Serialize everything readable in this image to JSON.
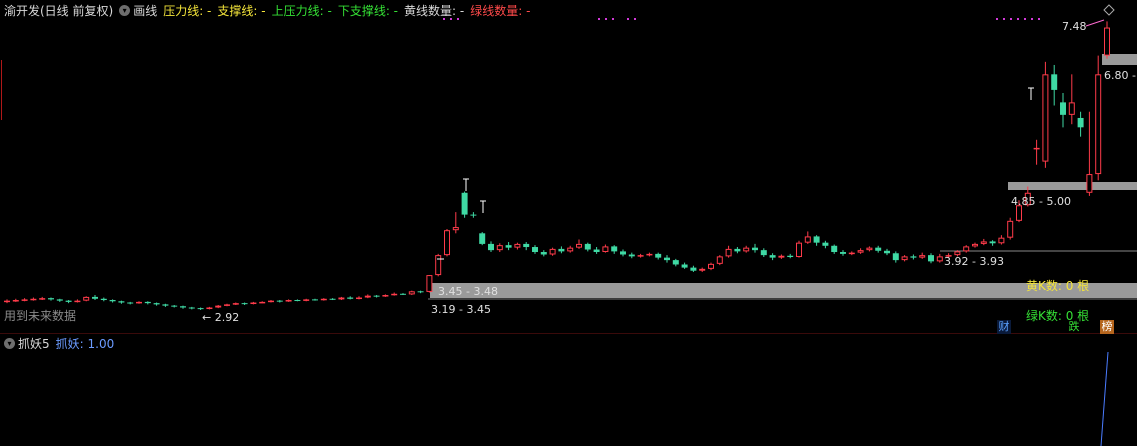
{
  "header": {
    "stock_name": "渝开发(日线 前复权)",
    "draw_label": "画线",
    "items": [
      {
        "label": "压力线: -",
        "color": "#f5e63a"
      },
      {
        "label": "支撑线: -",
        "color": "#f5e63a"
      },
      {
        "label": "上压力线: -",
        "color": "#35e035"
      },
      {
        "label": "下支撑线: -",
        "color": "#35e035"
      },
      {
        "label": "黄线数量: -",
        "color": "#d8d8d8"
      },
      {
        "label": "绿线数量: -",
        "color": "#ff4a4a"
      }
    ]
  },
  "sub_header": {
    "indicator": "抓妖5",
    "value_label": "抓妖: 1.00"
  },
  "annotations": {
    "future_data": "用到未来数据",
    "low_price": "← 2.92",
    "high_price": "7.48",
    "zone_345_348": "3.45 - 3.48",
    "zone_319_345": "3.19 - 3.45",
    "zone_392_393": "3.92 - 3.93",
    "zone_485_500": "4.85 - 5.00",
    "zone_680": "6.80 -",
    "yellow_k": "黄K数: 0 根",
    "green_k": "绿K数: 0 根",
    "badge_cai": "财",
    "badge_die": "跌",
    "badge_bang": "榜"
  },
  "colors": {
    "up": "#ff3b4a",
    "down": "#3fd9a4",
    "zone": "#9a9a9a",
    "magenta": "#d23ad8",
    "indicator_line": "#4a7cff"
  },
  "chart_data": {
    "type": "candlestick",
    "title": "渝开发(日线 前复权)",
    "ylim": [
      2.6,
      7.8
    ],
    "annotated_levels": {
      "low": 2.92,
      "high": 7.48
    },
    "zones": [
      {
        "label": "3.45 - 3.48",
        "low": 3.45,
        "high": 3.48
      },
      {
        "label": "3.19 - 3.45",
        "low": 3.19,
        "high": 3.45
      },
      {
        "label": "3.92 - 3.93",
        "low": 3.92,
        "high": 3.93
      },
      {
        "label": "4.85 - 5.00",
        "low": 4.85,
        "high": 5.0
      },
      {
        "label": "6.80 -",
        "low": 6.8,
        "high": 7.0
      }
    ],
    "candles": [
      [
        3.06,
        3.07,
        3.03,
        3.09
      ],
      [
        3.07,
        3.08,
        3.05,
        3.1
      ],
      [
        3.08,
        3.09,
        3.06,
        3.11
      ],
      [
        3.09,
        3.1,
        3.07,
        3.12
      ],
      [
        3.1,
        3.11,
        3.08,
        3.13
      ],
      [
        3.11,
        3.09,
        3.07,
        3.12
      ],
      [
        3.09,
        3.07,
        3.05,
        3.1
      ],
      [
        3.07,
        3.05,
        3.03,
        3.08
      ],
      [
        3.05,
        3.07,
        3.04,
        3.09
      ],
      [
        3.07,
        3.13,
        3.06,
        3.14
      ],
      [
        3.13,
        3.1,
        3.08,
        3.16
      ],
      [
        3.1,
        3.08,
        3.06,
        3.12
      ],
      [
        3.08,
        3.06,
        3.04,
        3.09
      ],
      [
        3.06,
        3.04,
        3.02,
        3.07
      ],
      [
        3.04,
        3.03,
        3.01,
        3.05
      ],
      [
        3.03,
        3.05,
        3.02,
        3.06
      ],
      [
        3.05,
        3.03,
        3.01,
        3.06
      ],
      [
        3.03,
        3.01,
        2.99,
        3.04
      ],
      [
        3.01,
        2.99,
        2.97,
        3.02
      ],
      [
        2.99,
        2.98,
        2.96,
        3.0
      ],
      [
        2.98,
        2.96,
        2.94,
        2.99
      ],
      [
        2.96,
        2.95,
        2.93,
        2.97
      ],
      [
        2.95,
        2.94,
        2.92,
        2.96
      ],
      [
        2.94,
        2.96,
        2.93,
        2.97
      ],
      [
        2.96,
        2.99,
        2.95,
        3.0
      ],
      [
        2.99,
        3.01,
        2.98,
        3.02
      ],
      [
        3.01,
        3.03,
        3.0,
        3.04
      ],
      [
        3.03,
        3.02,
        3.0,
        3.04
      ],
      [
        3.02,
        3.04,
        3.01,
        3.05
      ],
      [
        3.04,
        3.05,
        3.03,
        3.06
      ],
      [
        3.05,
        3.07,
        3.04,
        3.08
      ],
      [
        3.07,
        3.06,
        3.04,
        3.08
      ],
      [
        3.06,
        3.08,
        3.05,
        3.09
      ],
      [
        3.08,
        3.07,
        3.06,
        3.09
      ],
      [
        3.07,
        3.09,
        3.06,
        3.1
      ],
      [
        3.09,
        3.08,
        3.07,
        3.1
      ],
      [
        3.08,
        3.1,
        3.07,
        3.11
      ],
      [
        3.1,
        3.09,
        3.08,
        3.11
      ],
      [
        3.09,
        3.12,
        3.08,
        3.13
      ],
      [
        3.12,
        3.1,
        3.09,
        3.14
      ],
      [
        3.1,
        3.12,
        3.09,
        3.14
      ],
      [
        3.12,
        3.15,
        3.11,
        3.17
      ],
      [
        3.15,
        3.14,
        3.12,
        3.16
      ],
      [
        3.14,
        3.16,
        3.13,
        3.17
      ],
      [
        3.16,
        3.18,
        3.15,
        3.2
      ],
      [
        3.18,
        3.17,
        3.16,
        3.19
      ],
      [
        3.17,
        3.22,
        3.16,
        3.23
      ],
      [
        3.22,
        3.21,
        3.19,
        3.23
      ],
      [
        3.21,
        3.48,
        3.2,
        3.48
      ],
      [
        3.48,
        3.8,
        3.46,
        3.82
      ],
      [
        3.8,
        4.2,
        3.78,
        4.22
      ],
      [
        4.2,
        4.25,
        4.15,
        4.49
      ],
      [
        4.8,
        4.45,
        4.4,
        4.82
      ],
      [
        4.45,
        4.44,
        4.4,
        4.49
      ],
      [
        4.15,
        3.98,
        3.96,
        4.17
      ],
      [
        3.98,
        3.88,
        3.85,
        4.02
      ],
      [
        3.88,
        3.96,
        3.85,
        3.99
      ],
      [
        3.96,
        3.92,
        3.88,
        4.01
      ],
      [
        3.92,
        3.98,
        3.89,
        4.0
      ],
      [
        3.98,
        3.93,
        3.88,
        4.01
      ],
      [
        3.93,
        3.85,
        3.82,
        3.96
      ],
      [
        3.85,
        3.81,
        3.78,
        3.88
      ],
      [
        3.81,
        3.9,
        3.79,
        3.92
      ],
      [
        3.9,
        3.86,
        3.83,
        3.94
      ],
      [
        3.86,
        3.92,
        3.84,
        3.95
      ],
      [
        3.92,
        3.98,
        3.9,
        4.05
      ],
      [
        3.98,
        3.89,
        3.86,
        4.0
      ],
      [
        3.89,
        3.85,
        3.82,
        3.93
      ],
      [
        3.85,
        3.94,
        3.84,
        3.97
      ],
      [
        3.94,
        3.86,
        3.82,
        3.96
      ],
      [
        3.86,
        3.81,
        3.78,
        3.89
      ],
      [
        3.81,
        3.78,
        3.75,
        3.84
      ],
      [
        3.78,
        3.8,
        3.76,
        3.82
      ],
      [
        3.8,
        3.82,
        3.78,
        3.84
      ],
      [
        3.82,
        3.76,
        3.73,
        3.84
      ],
      [
        3.76,
        3.72,
        3.68,
        3.8
      ],
      [
        3.72,
        3.65,
        3.62,
        3.74
      ],
      [
        3.65,
        3.6,
        3.58,
        3.68
      ],
      [
        3.6,
        3.55,
        3.53,
        3.63
      ],
      [
        3.55,
        3.58,
        3.53,
        3.6
      ],
      [
        3.58,
        3.66,
        3.56,
        3.68
      ],
      [
        3.66,
        3.78,
        3.64,
        3.8
      ],
      [
        3.78,
        3.9,
        3.76,
        3.95
      ],
      [
        3.9,
        3.86,
        3.83,
        3.93
      ],
      [
        3.86,
        3.92,
        3.84,
        3.95
      ],
      [
        3.92,
        3.88,
        3.84,
        3.98
      ],
      [
        3.88,
        3.8,
        3.77,
        3.91
      ],
      [
        3.8,
        3.76,
        3.72,
        3.83
      ],
      [
        3.76,
        3.79,
        3.74,
        3.81
      ],
      [
        3.79,
        3.77,
        3.75,
        3.82
      ],
      [
        3.77,
        4.0,
        3.76,
        4.03
      ],
      [
        4.0,
        4.1,
        3.98,
        4.18
      ],
      [
        4.1,
        4.0,
        3.95,
        4.12
      ],
      [
        4.0,
        3.95,
        3.91,
        4.03
      ],
      [
        3.95,
        3.85,
        3.82,
        3.97
      ],
      [
        3.85,
        3.82,
        3.79,
        3.88
      ],
      [
        3.82,
        3.84,
        3.8,
        3.86
      ],
      [
        3.84,
        3.88,
        3.82,
        3.91
      ],
      [
        3.88,
        3.92,
        3.86,
        3.94
      ],
      [
        3.92,
        3.87,
        3.84,
        3.95
      ],
      [
        3.87,
        3.83,
        3.8,
        3.9
      ],
      [
        3.83,
        3.72,
        3.68,
        3.86
      ],
      [
        3.72,
        3.78,
        3.7,
        3.8
      ],
      [
        3.78,
        3.76,
        3.73,
        3.81
      ],
      [
        3.76,
        3.8,
        3.74,
        3.84
      ],
      [
        3.8,
        3.7,
        3.67,
        3.83
      ],
      [
        3.7,
        3.78,
        3.68,
        3.82
      ],
      [
        3.78,
        3.8,
        3.76,
        3.83
      ],
      [
        3.8,
        3.86,
        3.78,
        3.88
      ],
      [
        3.86,
        3.94,
        3.84,
        3.96
      ],
      [
        3.94,
        3.98,
        3.92,
        4.0
      ],
      [
        3.98,
        4.02,
        3.96,
        4.06
      ],
      [
        4.02,
        3.99,
        3.95,
        4.04
      ],
      [
        3.99,
        4.08,
        3.97,
        4.12
      ],
      [
        4.08,
        4.35,
        4.05,
        4.4
      ],
      [
        4.35,
        4.6,
        4.33,
        4.68
      ],
      [
        4.6,
        4.8,
        4.58,
        4.9
      ],
      [
        5.5,
        5.52,
        5.25,
        5.65
      ],
      [
        5.3,
        6.7,
        5.2,
        6.9
      ],
      [
        6.7,
        6.45,
        6.2,
        6.85
      ],
      [
        6.25,
        6.05,
        5.85,
        6.4
      ],
      [
        6.05,
        6.25,
        5.9,
        6.7
      ],
      [
        6.0,
        5.85,
        5.7,
        6.1
      ],
      [
        4.8,
        5.1,
        4.75,
        6.1
      ],
      [
        5.1,
        6.7,
        5.0,
        7.0
      ],
      [
        7.0,
        7.45,
        6.95,
        7.55
      ]
    ],
    "sub_indicator": {
      "name": "抓妖",
      "value": 1.0
    }
  }
}
